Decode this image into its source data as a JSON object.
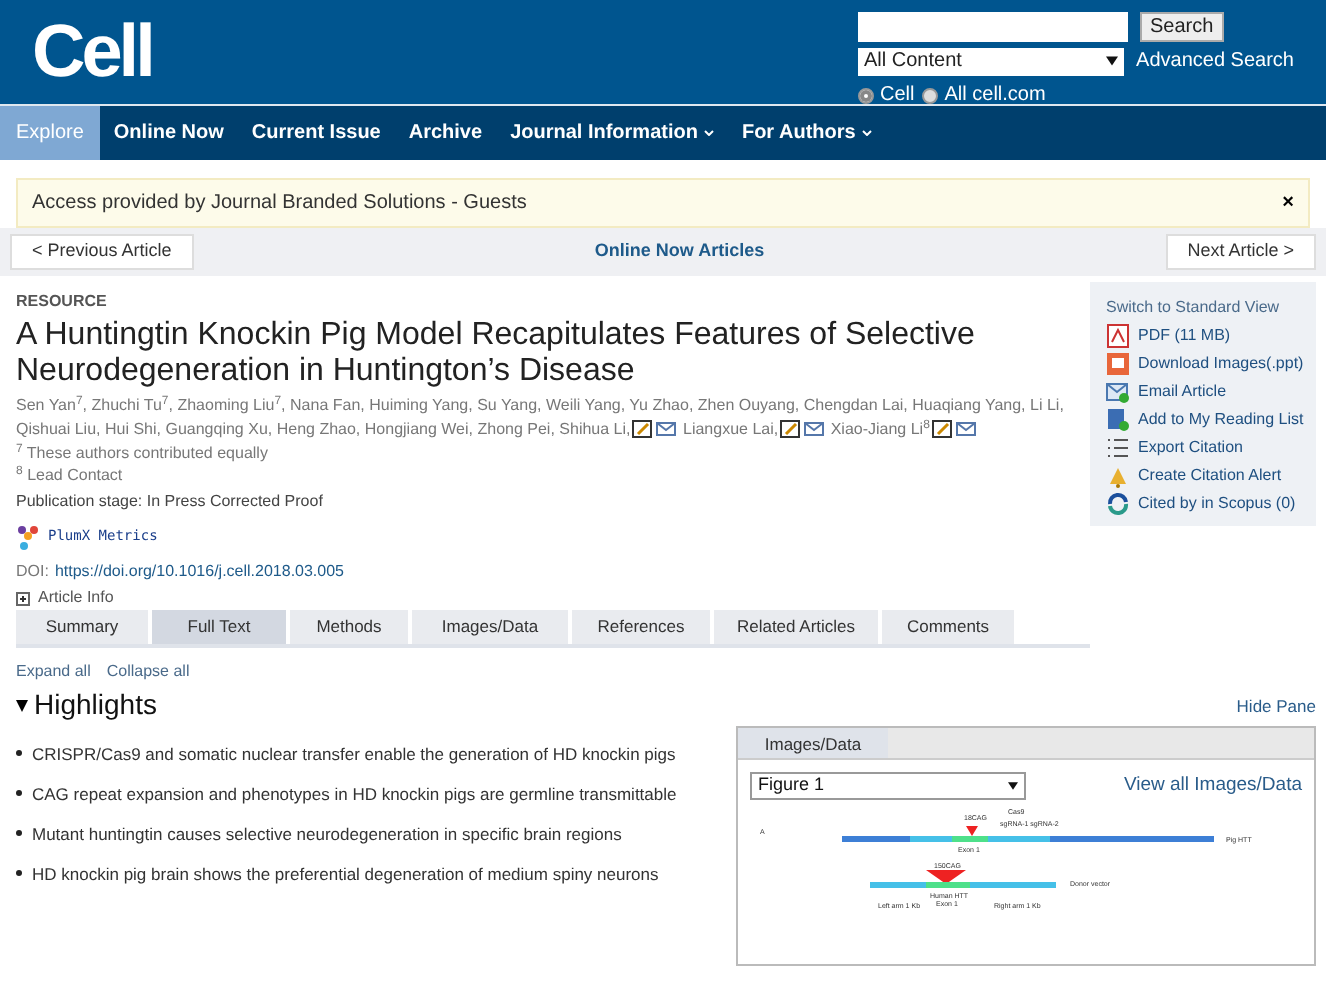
{
  "header": {
    "logo": "Cell",
    "search": {
      "button": "Search",
      "scope": "All Content",
      "advanced": "Advanced Search",
      "radios": [
        {
          "label": "Cell",
          "selected": true
        },
        {
          "label": "All cell.com",
          "selected": false
        }
      ]
    }
  },
  "nav": [
    {
      "label": "Explore",
      "selected": true,
      "dropdown": false
    },
    {
      "label": "Online Now",
      "selected": false,
      "dropdown": false
    },
    {
      "label": "Current Issue",
      "selected": false,
      "dropdown": false
    },
    {
      "label": "Archive",
      "selected": false,
      "dropdown": false
    },
    {
      "label": "Journal Information",
      "selected": false,
      "dropdown": true
    },
    {
      "label": "For Authors",
      "selected": false,
      "dropdown": true
    }
  ],
  "banner": {
    "text": "Access provided by Journal Branded Solutions - Guests",
    "close": "×"
  },
  "article_nav": {
    "previous": "< Previous Article",
    "center": "Online Now Articles",
    "next": "Next Article >"
  },
  "article": {
    "type": "RESOURCE",
    "title": "A Huntingtin Knockin Pig Model Recapitulates Features of Selective Neurodegeneration in Huntington’s Disease",
    "authors": [
      {
        "name": "Sen Yan$^{7}$,",
        "contact": false
      },
      {
        "name": "Zhuchi Tu$^{7}$,",
        "contact": false
      },
      {
        "name": "Zhaoming Liu$^{7}$,",
        "contact": false
      },
      {
        "name": "Nana Fan,",
        "contact": false
      },
      {
        "name": "Huiming Yang,",
        "contact": false
      },
      {
        "name": "Su Yang,",
        "contact": false
      },
      {
        "name": "Weili Yang,",
        "contact": false
      },
      {
        "name": "Yu Zhao,",
        "contact": false
      },
      {
        "name": "Zhen Ouyang,",
        "contact": false
      },
      {
        "name": "Chengdan Lai,",
        "contact": false
      },
      {
        "name": "Huaqiang Yang,",
        "contact": false
      },
      {
        "name": "Li Li,",
        "contact": false
      },
      {
        "name": "Qishuai Liu,",
        "contact": false
      },
      {
        "name": "Hui Shi,",
        "contact": false
      },
      {
        "name": "Guangqing Xu,",
        "contact": false
      },
      {
        "name": "Heng Zhao,",
        "contact": false
      },
      {
        "name": "Hongjiang Wei,",
        "contact": false
      },
      {
        "name": "Zhong Pei,",
        "contact": false
      },
      {
        "name": "Shihua Li,",
        "contact": true
      },
      {
        "name": "Liangxue Lai,",
        "contact": true
      },
      {
        "name": "Xiao-Jiang Li$^{8}$",
        "contact": true
      }
    ],
    "notes": [
      "$^{7}$ These authors contributed equally",
      "$^{8}$ Lead Contact"
    ],
    "stage": "Publication stage: In Press Corrected Proof",
    "plumx": "PlumX Metrics",
    "doi_label": "DOI:",
    "doi": "https://doi.org/10.1016/j.cell.2018.03.005",
    "article_info": "Article Info"
  },
  "sidebar": {
    "switch": "Switch to Standard View",
    "items": [
      "PDF (11 MB)",
      "Download Images(.ppt)",
      "Email Article",
      "Add to My Reading List",
      "Export Citation",
      "Create Citation Alert",
      "Cited by in Scopus (0)"
    ]
  },
  "tabs": [
    {
      "label": "Summary",
      "selected": false
    },
    {
      "label": "Full Text",
      "selected": true
    },
    {
      "label": "Methods",
      "selected": false
    },
    {
      "label": "Images/Data",
      "selected": false
    },
    {
      "label": "References",
      "selected": false
    },
    {
      "label": "Related Articles",
      "selected": false
    },
    {
      "label": "Comments",
      "selected": false
    }
  ],
  "expand": "Expand all",
  "collapse": "Collapse all",
  "highlights": {
    "title": "Highlights",
    "expanded": true,
    "items": [
      "CRISPR/Cas9 and somatic nuclear transfer enable the generation of HD knockin pigs",
      "CAG repeat expansion and phenotypes in HD knockin pigs are germline transmittable",
      "Mutant huntingtin causes selective neurodegeneration in specific brain regions",
      "HD knockin pig brain shows the preferential degeneration of medium spiny neurons"
    ]
  },
  "pane": {
    "hide": "Hide Pane",
    "tab": "Images/Data",
    "figure_select": "Figure 1",
    "view_all": "View all Images/Data",
    "figure_labels": [
      "Cas9",
      "18CAG",
      "sgRNA-1 sgRNA-2",
      "A",
      "Pig HTT",
      "Exon 1",
      "150CAG",
      "Donor vector",
      "Human HTT",
      "Exon 1",
      "Left arm 1 Kb",
      "Right arm 1 Kb"
    ]
  }
}
